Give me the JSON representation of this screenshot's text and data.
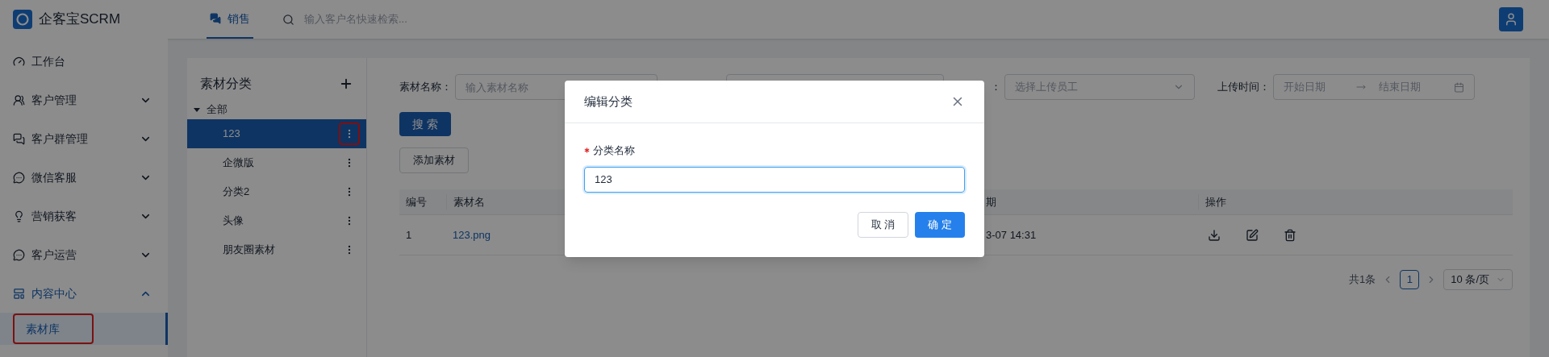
{
  "brand": {
    "name": "企客宝SCRM"
  },
  "top_tabs": [
    {
      "label": "销售",
      "selected": true
    }
  ],
  "global_search": {
    "placeholder": "输入客户名快速检索..."
  },
  "sidebar": {
    "items": [
      {
        "label": "工作台",
        "kind": "link"
      },
      {
        "label": "客户管理",
        "kind": "group",
        "expanded": false
      },
      {
        "label": "客户群管理",
        "kind": "group",
        "expanded": false
      },
      {
        "label": "微信客服",
        "kind": "group",
        "expanded": false
      },
      {
        "label": "营销获客",
        "kind": "group",
        "expanded": false
      },
      {
        "label": "客户运营",
        "kind": "group",
        "expanded": false
      },
      {
        "label": "内容中心",
        "kind": "group",
        "expanded": true,
        "children": [
          {
            "label": "素材库",
            "selected": true,
            "highlighted": true
          }
        ]
      }
    ]
  },
  "category_panel": {
    "title": "素材分类",
    "root": {
      "label": "全部",
      "expanded": true,
      "children": [
        {
          "label": "123",
          "selected": true,
          "highlighted": true
        },
        {
          "label": "企微版",
          "selected": false,
          "highlighted": false
        },
        {
          "label": "分类2",
          "selected": false,
          "highlighted": false
        },
        {
          "label": "头像",
          "selected": false,
          "highlighted": false
        },
        {
          "label": "朋友圈素材",
          "selected": false,
          "highlighted": false
        }
      ]
    }
  },
  "filters": [
    {
      "kind": "text",
      "label": "素材名称：",
      "placeholder": "输入素材名称"
    },
    {
      "kind": "text"
    },
    {
      "kind": "select",
      "label": "：",
      "placeholder": "选择上传员工"
    },
    {
      "kind": "date_range",
      "label": "上传时间：",
      "start_placeholder": "开始日期",
      "end_placeholder": "结束日期"
    }
  ],
  "search_button": "搜 索",
  "add_button": "添加素材",
  "table": {
    "columns": [
      "编号",
      "素材名",
      "期",
      "操作"
    ],
    "rows": [
      {
        "number": "1",
        "name": "123.png",
        "column_3": "3-07 14:31"
      }
    ]
  },
  "pagination": {
    "total": "共1条",
    "pages": [
      {
        "label": "1",
        "selected": true
      }
    ],
    "page_size": "10 条/页"
  },
  "dialog": {
    "title": "编辑分类",
    "field": {
      "label": "分类名称",
      "required": true,
      "value": "123"
    },
    "cancel": "取 消",
    "confirm": "确 定"
  }
}
